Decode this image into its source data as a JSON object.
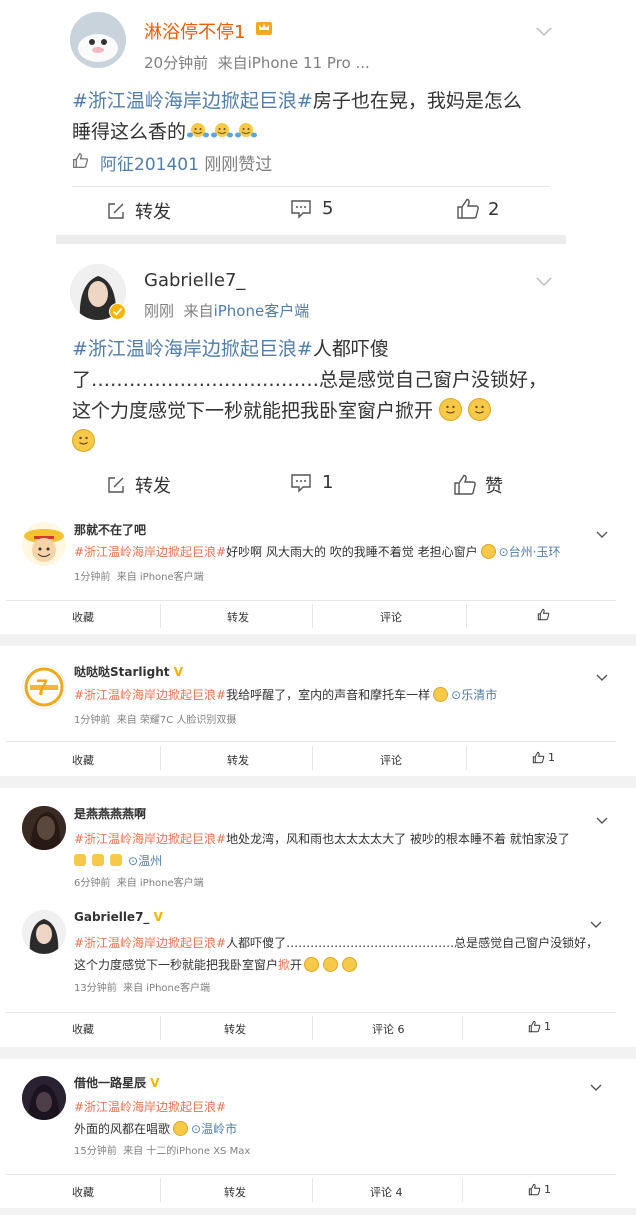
{
  "post1": {
    "username": "淋浴停不停1",
    "meta_time": "20分钟前",
    "meta_source": "来自iPhone 11 Pro ...",
    "hashtag": "#浙江温岭海岸边掀起巨浪#",
    "text_a": "房子也在晃，我妈是怎么",
    "text_b": "睡得这么香的",
    "like_user": "阿征201401",
    "like_suffix": "刚刚赞过",
    "repost_label": "转发",
    "comment_count": "5",
    "like_count": "2"
  },
  "post2": {
    "username": "Gabrielle7_",
    "meta_time": "刚刚",
    "meta_source_prefix": "来自",
    "meta_source_link": "iPhone客户端",
    "hashtag": "#浙江温岭海岸边掀起巨浪#",
    "line1": "人都吓傻",
    "line2": "了………………………………总是感觉自己窗户没锁好，",
    "line3": "这个力度感觉下一秒就能把我卧室窗户掀开",
    "repost_label": "转发",
    "comment_count": "1",
    "like_label": "赞"
  },
  "posts": [
    {
      "username": "那就不在了吧",
      "hashtag": "#浙江温岭海岸边掀起巨浪#",
      "text": "好吵啊 风大雨大的 吹的我睡不着觉 老担心窗户",
      "location": "台州·玉环",
      "meta": "1分钟前  来自 iPhone客户端",
      "actions": [
        "收藏",
        "转发",
        "评论",
        ""
      ]
    },
    {
      "username": "哒哒哒Starlight",
      "hashtag": "#浙江温岭海岸边掀起巨浪#",
      "text": "我给呼醒了，室内的声音和摩托车一样",
      "location": "乐清市",
      "meta": "1分钟前  来自 荣耀7C 人脸识别双摄",
      "actions": [
        "收藏",
        "转发",
        "评论",
        "1"
      ]
    },
    {
      "username": "是燕燕燕燕啊",
      "hashtag": "#浙江温岭海岸边掀起巨浪#",
      "text": "地处龙湾，风和雨也太太太太大了 被吵的根本睡不着 就怕家没了",
      "location": "温州",
      "meta": "6分钟前  来自 iPhone客户端",
      "actions": []
    },
    {
      "username": "Gabrielle7_",
      "hashtag": "#浙江温岭海岸边掀起巨浪#",
      "text_a": "人都吓傻了……………………………………总是感觉自己窗户没锁好，",
      "text_b1": "这个力度感觉下一秒就能把我卧室窗户",
      "text_b_red": "掀",
      "text_b2": "开",
      "meta": "13分钟前  来自 iPhone客户端",
      "actions": [
        "收藏",
        "转发",
        "评论 6",
        "1"
      ]
    },
    {
      "username": "借他一路星辰",
      "hashtag": "#浙江温岭海岸边掀起巨浪#",
      "text": "外面的风都在唱歌",
      "location": "温岭市",
      "meta": "15分钟前  来自 十二的iPhone XS Max",
      "actions": [
        "收藏",
        "转发",
        "评论 4",
        "1"
      ]
    }
  ],
  "colors": {
    "link": "#507daf",
    "tag_red": "#eb7350",
    "vip": "#f4b400",
    "username_orange": "#f25c05"
  }
}
